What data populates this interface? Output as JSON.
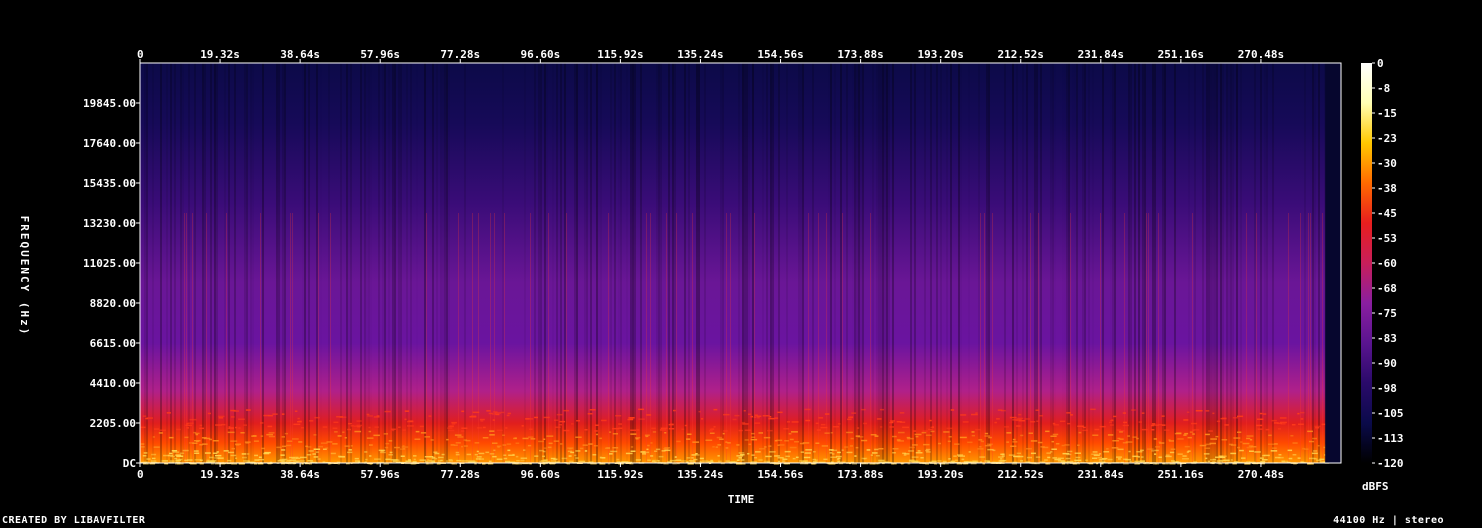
{
  "chart_data": {
    "type": "heatmap",
    "xlabel": "TIME",
    "ylabel": "FREQUENCY (Hz)",
    "x_ticks": [
      "0",
      "19.32s",
      "38.64s",
      "57.96s",
      "77.28s",
      "96.60s",
      "115.92s",
      "135.24s",
      "154.56s",
      "173.88s",
      "193.20s",
      "212.52s",
      "231.84s",
      "251.16s",
      "270.48s"
    ],
    "x_tick_values": [
      0,
      19.32,
      38.64,
      57.96,
      77.28,
      96.6,
      115.92,
      135.24,
      154.56,
      173.88,
      193.2,
      212.52,
      231.84,
      251.16,
      270.48
    ],
    "xlim": [
      0,
      289.8
    ],
    "y_ticks": [
      "DC",
      "2205.00",
      "4410.00",
      "6615.00",
      "8820.00",
      "11025.00",
      "13230.00",
      "15435.00",
      "17640.00",
      "19845.00"
    ],
    "y_tick_values": [
      0,
      2205,
      4410,
      6615,
      8820,
      11025,
      13230,
      15435,
      17640,
      19845
    ],
    "ylim": [
      0,
      22050
    ],
    "colorbar": {
      "label": "dBFS",
      "ticks": [
        "0",
        "-8",
        "-15",
        "-23",
        "-30",
        "-38",
        "-45",
        "-53",
        "-60",
        "-68",
        "-75",
        "-83",
        "-90",
        "-98",
        "-105",
        "-113",
        "-120"
      ],
      "range": [
        -120,
        0
      ]
    },
    "colors": {
      "background": "#000000",
      "scale": [
        "#000000",
        "#0a0a4a",
        "#2a0a6a",
        "#5a1490",
        "#8a1ea0",
        "#c81e5a",
        "#e81e1e",
        "#ff6a00",
        "#ffc800",
        "#ffffb4",
        "#ffffff"
      ]
    }
  },
  "footer": {
    "credit": "CREATED BY LIBAVFILTER",
    "format": "44100 Hz | stereo"
  }
}
